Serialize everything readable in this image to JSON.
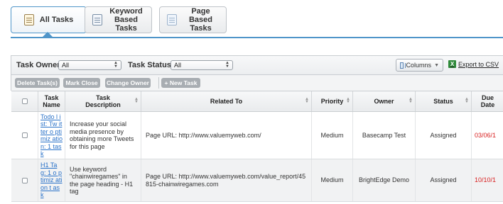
{
  "tabs": [
    {
      "label": "All Tasks",
      "active": true,
      "icon": "clipboard-icon"
    },
    {
      "label": "Keyword\nBased Tasks",
      "active": false,
      "icon": "list-icon"
    },
    {
      "label": "Page\nBased Tasks",
      "active": false,
      "icon": "page-icon"
    }
  ],
  "filters": {
    "owner_label": "Task Owner:",
    "owner_value": "All",
    "status_label": "Task Status:",
    "status_value": "All",
    "columns_label": "Columns",
    "export_label": "Export to CSV"
  },
  "actions": {
    "delete": "Delete Task(s)",
    "mark_close": "Mark Close",
    "change_owner": "Change Owner",
    "new_task": "+ New Task"
  },
  "table": {
    "headers": {
      "task_name": "Task\nName",
      "task_description": "Task\nDescription",
      "related_to": "Related To",
      "priority": "Priority",
      "owner": "Owner",
      "status": "Status",
      "due_date": "Due\nDate"
    },
    "rows": [
      {
        "name": "Todo l ist: Tw itter o ptimiz ation: 1 task",
        "description": "Increase your social media presence by obtaining more Tweets for this page",
        "related": "Page URL: http://www.valuemyweb.com/",
        "priority": "Medium",
        "owner": "Basecamp Test",
        "status": "Assigned",
        "due": "03/06/1"
      },
      {
        "name": "H1 Ta g: 1 o ptimiz ation t ask",
        "description": "Use keyword \"chainwiregames\" in the page heading - H1 tag",
        "related": "Page URL: http://www.valuemyweb.com/value_report/45815-chainwiregames.com",
        "priority": "Medium",
        "owner": "BrightEdge Demo",
        "status": "Assigned",
        "due": "10/10/1"
      }
    ]
  }
}
